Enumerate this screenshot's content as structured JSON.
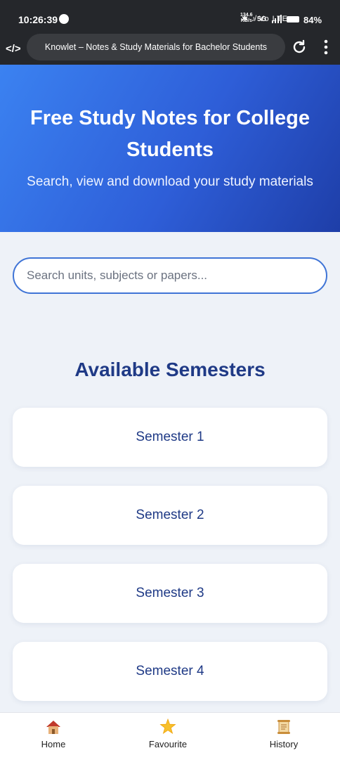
{
  "status_bar": {
    "time": "10:26:39",
    "indicators": "✱ ♪̸ Vo LTE",
    "net_speed_top": "134.6",
    "net_speed_bottom": "KB/s",
    "network": "5G",
    "battery": "84%"
  },
  "browser": {
    "tab_title": "Knowlet – Notes & Study Materials for Bachelor Students",
    "site_icon": "</>",
    "reload_icon": "reload-icon",
    "menu_icon": "more-vertical-icon"
  },
  "hero": {
    "title": "Free Study Notes for College Students",
    "subtitle": "Search, view and download your study materials"
  },
  "search": {
    "placeholder": "Search units, subjects or papers...",
    "value": ""
  },
  "semesters": {
    "heading": "Available Semesters",
    "items": [
      "Semester 1",
      "Semester 2",
      "Semester 3",
      "Semester 4"
    ]
  },
  "bottom_nav": {
    "items": [
      {
        "label": "Home",
        "icon": "house-icon"
      },
      {
        "label": "Favourite",
        "icon": "star-icon"
      },
      {
        "label": "History",
        "icon": "scroll-icon"
      }
    ]
  },
  "colors": {
    "hero_start": "#3b82f1",
    "hero_end": "#1e3ea8",
    "accent_text": "#1f3a86",
    "search_border": "#3f74d6",
    "page_bg": "#eef2f8"
  }
}
